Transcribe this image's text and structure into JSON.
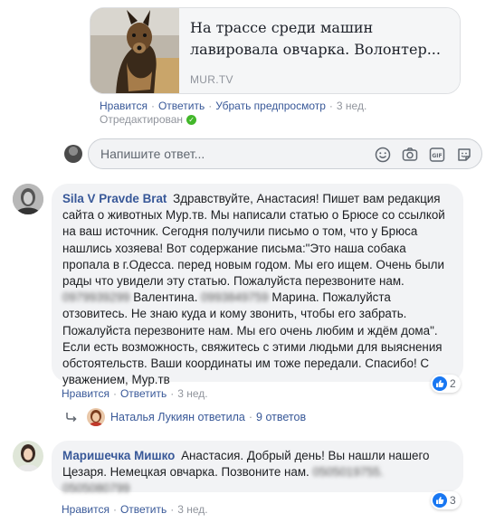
{
  "preview": {
    "title": "На трассе среди машин лавировала овчарка. Волонтер...",
    "source": "MUR.TV"
  },
  "top_actions": {
    "like": "Нравится",
    "reply": "Ответить",
    "remove_preview": "Убрать предпросмотр",
    "time": "3 нед.",
    "edited": "Отредактирован"
  },
  "reply_box": {
    "placeholder": "Напишите ответ..."
  },
  "comments": [
    {
      "author": "Sila V Pravde Brat",
      "text_1": "Здравствуйте, Анастасия! Пишет вам редакция сайта о животных Мур.тв. Мы написали статью о Брюсе со ссылкой на ваш источник. Сегодня получили письмо о том, что у Брюса нашлись хозяева! Вот содержание письма:\"Это наша собака пропала в г.Одесса. перед новым годом. Мы его ищем. Очень были рады что увидели эту статью. Пожалуйста перезвоните нам.",
      "redacted_1": "0979939299",
      "text_2": "Валентина.",
      "redacted_2": "0993849759",
      "text_3": "Марина. Пожалуйста отзовитесь. Не знаю куда и кому звонить, чтобы его забрать. Пожалуйста перезвоните нам. Мы его очень любим и ждём дома\". Если есть возможность, свяжитесь с этими людьми для выяснения обстоятельств. Ваши координаты им тоже передали. Спасибо! С уважением, Мур.тв",
      "like": "Нравится",
      "reply": "Ответить",
      "time": "3 нед.",
      "reactions": "2",
      "replies_author": "Наталья Лукиян ответила",
      "replies_count": "9 ответов"
    },
    {
      "author": "Маришечка Мишко",
      "text_1": "Анастасия. Добрый день! Вы нашли нашего Цезаря. Немецкая овчарка. Позвоните нам.",
      "redacted_1": "0505019755.",
      "redacted_2": "0505080799",
      "like": "Нравится",
      "reply": "Ответить",
      "time": "3 нед.",
      "reactions": "3"
    }
  ],
  "colors": {
    "link": "#385898",
    "bubble": "#f2f3f5",
    "like_blue": "#1877f2",
    "check_green": "#42b72a"
  }
}
